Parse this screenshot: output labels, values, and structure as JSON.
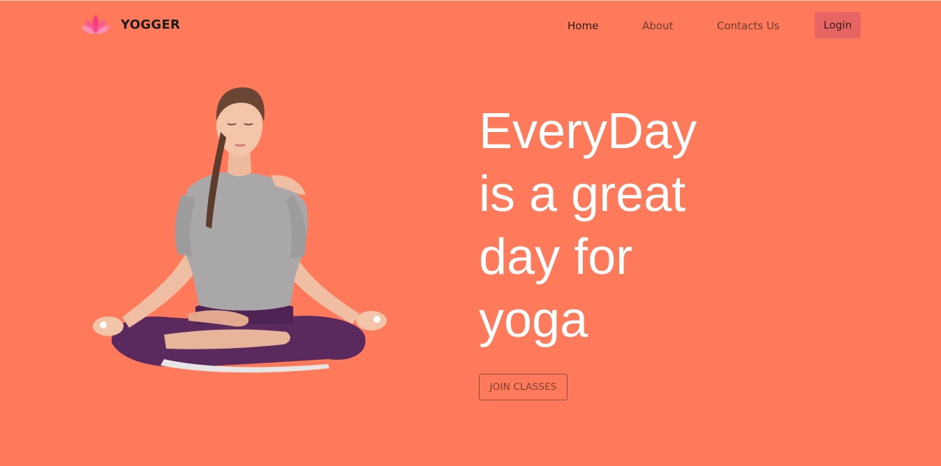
{
  "brand": {
    "name": "YOGGER",
    "logo_icon": "lotus-icon",
    "logo_colors": [
      "#f7407d",
      "#fb6fa0",
      "#ff97bd"
    ]
  },
  "nav": {
    "items": [
      {
        "label": "Home",
        "active": true
      },
      {
        "label": "About",
        "active": false
      },
      {
        "label": "Contacts Us",
        "active": false
      }
    ],
    "login_label": "Login"
  },
  "hero": {
    "headline_lines": [
      "EveryDay",
      "is a great",
      "day for",
      "yoga"
    ],
    "cta_label": "JOIN CLASSES",
    "image_subject": "woman-meditating-lotus-pose-image"
  },
  "colors": {
    "background": "#fe7a5b",
    "login_button": "#e76562",
    "headline": "#ffffff"
  }
}
